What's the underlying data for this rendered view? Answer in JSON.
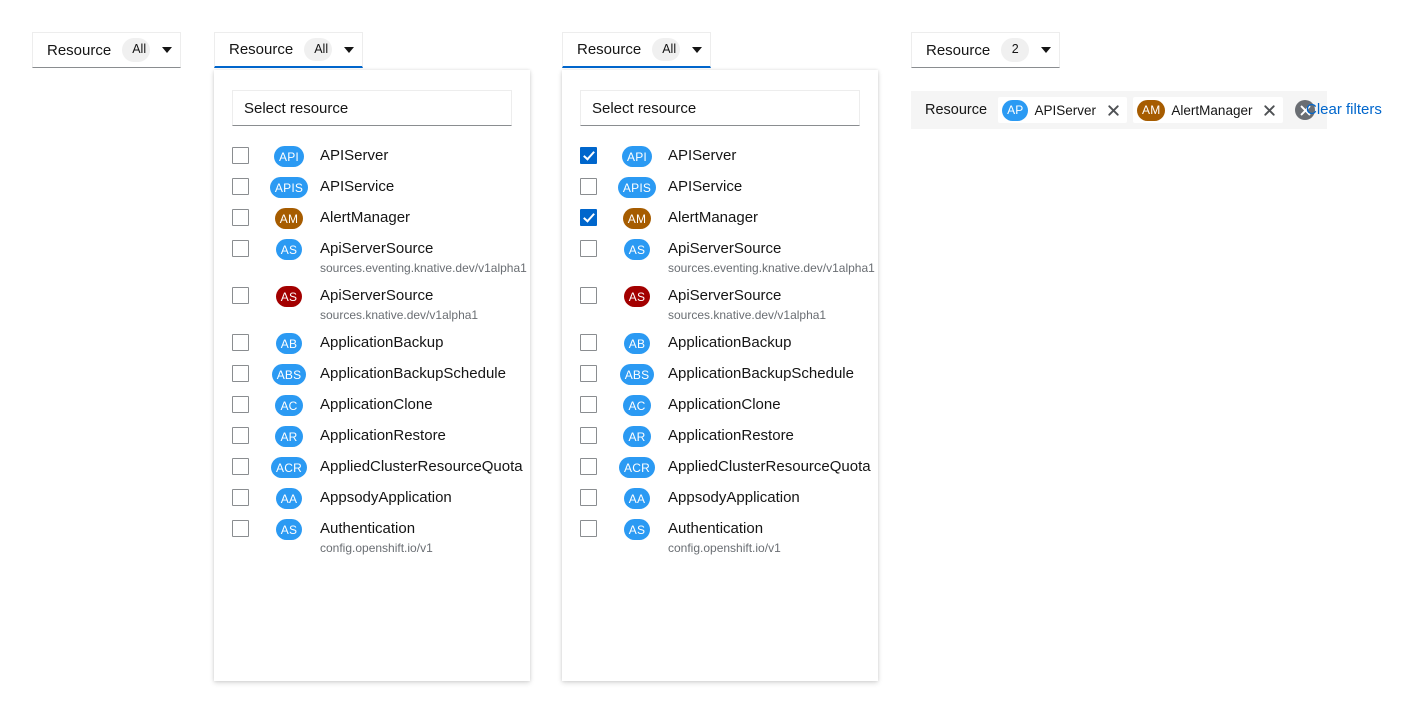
{
  "colors": {
    "blue": "#2b9af3",
    "brown": "#a65c00",
    "darkred": "#a30000",
    "accent": "#06c",
    "link": "#06c"
  },
  "toggles": [
    {
      "id": "t1",
      "label": "Resource",
      "badge": "All",
      "expanded": false
    },
    {
      "id": "t2",
      "label": "Resource",
      "badge": "All",
      "expanded": true
    },
    {
      "id": "t3",
      "label": "Resource",
      "badge": "All",
      "expanded": true
    },
    {
      "id": "t4",
      "label": "Resource",
      "badge": "2",
      "expanded": false
    }
  ],
  "search": {
    "placeholder": "Select resource",
    "value": ""
  },
  "options": [
    {
      "abbr": "API",
      "color": "#2b9af3",
      "name": "APIServer",
      "sub": ""
    },
    {
      "abbr": "APIS",
      "color": "#2b9af3",
      "name": "APIService",
      "sub": ""
    },
    {
      "abbr": "AM",
      "color": "#a65c00",
      "name": "AlertManager",
      "sub": ""
    },
    {
      "abbr": "AS",
      "color": "#2b9af3",
      "name": "ApiServerSource",
      "sub": "sources.eventing.knative.dev/v1alpha1"
    },
    {
      "abbr": "AS",
      "color": "#a30000",
      "name": "ApiServerSource",
      "sub": "sources.knative.dev/v1alpha1"
    },
    {
      "abbr": "AB",
      "color": "#2b9af3",
      "name": "ApplicationBackup",
      "sub": ""
    },
    {
      "abbr": "ABS",
      "color": "#2b9af3",
      "name": "ApplicationBackupSchedule",
      "sub": ""
    },
    {
      "abbr": "AC",
      "color": "#2b9af3",
      "name": "ApplicationClone",
      "sub": ""
    },
    {
      "abbr": "AR",
      "color": "#2b9af3",
      "name": "ApplicationRestore",
      "sub": ""
    },
    {
      "abbr": "ACR",
      "color": "#2b9af3",
      "name": "AppliedClusterResourceQuota",
      "sub": ""
    },
    {
      "abbr": "AA",
      "color": "#2b9af3",
      "name": "AppsodyApplication",
      "sub": ""
    },
    {
      "abbr": "AS",
      "color": "#2b9af3",
      "name": "Authentication",
      "sub": "config.openshift.io/v1"
    }
  ],
  "checked_panel": [
    true,
    false,
    true,
    false,
    false,
    false,
    false,
    false,
    false,
    false,
    false,
    false
  ],
  "filter_bar": {
    "group_label": "Resource",
    "chips": [
      {
        "abbr": "AP",
        "color": "#2b9af3",
        "label": "APIServer"
      },
      {
        "abbr": "AM",
        "color": "#a65c00",
        "label": "AlertManager"
      }
    ],
    "clear_link": "Clear filters"
  }
}
